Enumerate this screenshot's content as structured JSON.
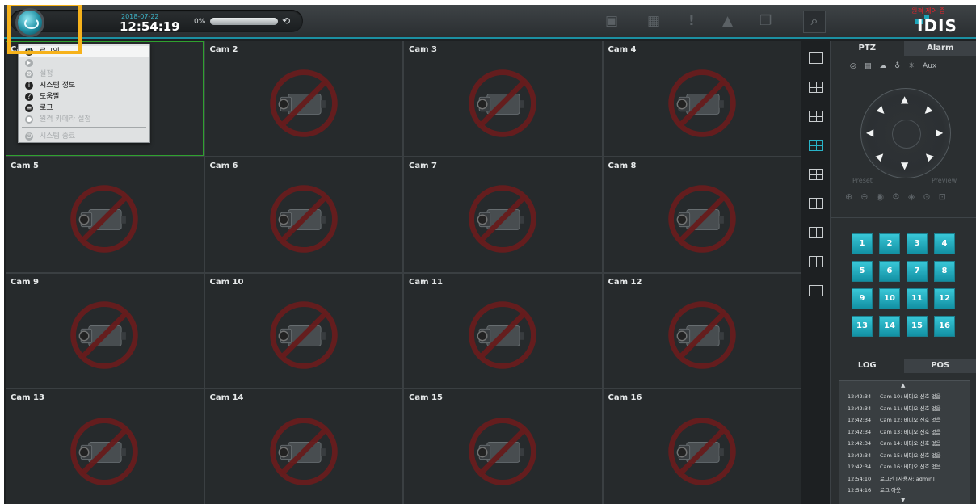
{
  "topbar": {
    "date": "2018-07-22",
    "time": "12:54:19",
    "progress_percent": "0%",
    "progress_value": 0,
    "history_icon": "history-icon",
    "icons": [
      "image-icon",
      "film-icon",
      "exclamation-icon",
      "bell-icon",
      "windows-icon",
      "search-icon"
    ],
    "brand": "IDIS",
    "top_right_tag": "원격 제어 중",
    "accent": "#1ea5b9"
  },
  "menu": {
    "items": [
      {
        "label": "로그인",
        "icon": "lock-icon",
        "enabled": true
      },
      {
        "label": "",
        "icon": "arrow-icon",
        "enabled": false
      },
      {
        "label": "설정",
        "icon": "gear-icon",
        "enabled": false
      },
      {
        "label": "시스템 정보",
        "icon": "info-icon",
        "enabled": true
      },
      {
        "label": "도움말",
        "icon": "help-icon",
        "enabled": true
      },
      {
        "label": "로그",
        "icon": "log-icon",
        "enabled": true
      },
      {
        "label": "원격 카메라 설정",
        "icon": "camera-settings-icon",
        "enabled": false
      },
      {
        "label": "시스템 종료",
        "icon": "power-icon",
        "enabled": false
      }
    ]
  },
  "cameras": [
    "Cam 1",
    "Cam 2",
    "Cam 3",
    "Cam 4",
    "Cam 5",
    "Cam 6",
    "Cam 7",
    "Cam 8",
    "Cam 9",
    "Cam 10",
    "Cam 11",
    "Cam 12",
    "Cam 13",
    "Cam 14",
    "Cam 15",
    "Cam 16"
  ],
  "layouts": [
    "layout-1x1-icon",
    "layout-2x2-icon",
    "layout-3x3-icon",
    "layout-4x4-icon",
    "layout-5x5-icon",
    "layout-1plus5-icon",
    "layout-6x6-icon",
    "layout-1plus7-icon",
    "fullscreen-icon"
  ],
  "ptz": {
    "tabs": [
      "PTZ",
      "Alarm"
    ],
    "tool_icons": [
      "focus-icon",
      "menu-icon",
      "cloud-icon",
      "bulb-icon",
      "light-icon"
    ],
    "aux": "Aux",
    "preset_label": "Preset",
    "preview_label": "Preview"
  },
  "camera_buttons": [
    "1",
    "2",
    "3",
    "4",
    "5",
    "6",
    "7",
    "8",
    "9",
    "10",
    "11",
    "12",
    "13",
    "14",
    "15",
    "16"
  ],
  "log": {
    "tabs": [
      "LOG",
      "POS"
    ],
    "entries": [
      {
        "time": "12:42:34",
        "text": "Cam 10: 비디오 신호 없음"
      },
      {
        "time": "12:42:34",
        "text": "Cam 11: 비디오 신호 없음"
      },
      {
        "time": "12:42:34",
        "text": "Cam 12: 비디오 신호 없음"
      },
      {
        "time": "12:42:34",
        "text": "Cam 13: 비디오 신호 없음"
      },
      {
        "time": "12:42:34",
        "text": "Cam 14: 비디오 신호 없음"
      },
      {
        "time": "12:42:34",
        "text": "Cam 15: 비디오 신호 없음"
      },
      {
        "time": "12:42:34",
        "text": "Cam 16: 비디오 신호 없음"
      },
      {
        "time": "12:54:10",
        "text": "로그인 [사용자: admin]"
      },
      {
        "time": "12:54:16",
        "text": "로그 아웃"
      }
    ]
  }
}
